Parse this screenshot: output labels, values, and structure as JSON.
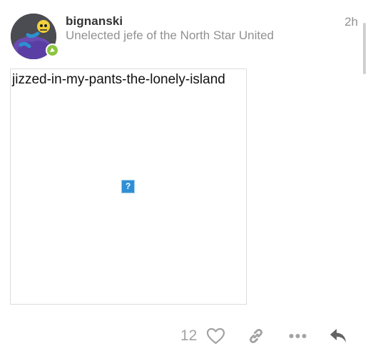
{
  "post": {
    "username": "bignanski",
    "user_title": "Unelected jefe of the North Star United",
    "date": "2h"
  },
  "embed": {
    "name": "jizzed-in-my-pants-the-lonely-island",
    "broken_glyph": "?"
  },
  "actions": {
    "like_count": "12",
    "icons": [
      "heart-icon",
      "link-icon",
      "more-icon",
      "reply-icon"
    ]
  },
  "colors": {
    "muted": "#919191",
    "flair": "#8bc53f",
    "broken_image": "#2f8fd6"
  }
}
